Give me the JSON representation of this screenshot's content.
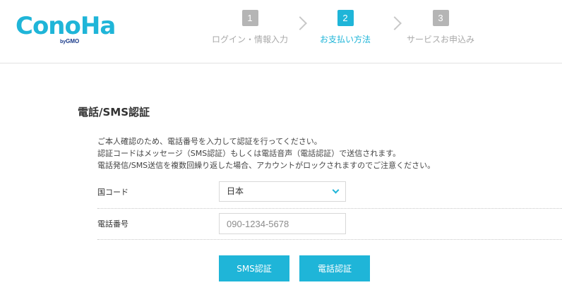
{
  "logo": {
    "text": "ConoHa",
    "by": "by",
    "brand": "GMO"
  },
  "steps": [
    {
      "number": "1",
      "label": "ログイン・情報入力",
      "state": "done"
    },
    {
      "number": "2",
      "label": "お支払い方法",
      "state": "active"
    },
    {
      "number": "3",
      "label": "サービスお申込み",
      "state": "upcoming"
    }
  ],
  "page_title": "電話/SMS認証",
  "description": [
    "ご本人確認のため、電話番号を入力して認証を行ってください。",
    "認証コードはメッセージ（SMS認証）もしくは電話音声（電話認証）で送信されます。",
    "電話発信/SMS送信を複数回繰り返した場合、アカウントがロックされますのでご注意ください。"
  ],
  "form": {
    "country_label": "国コード",
    "country_value": "日本",
    "phone_label": "電話番号",
    "phone_placeholder": "090-1234-5678",
    "phone_value": ""
  },
  "buttons": {
    "sms": "SMS認証",
    "voice": "電話認証"
  },
  "colors": {
    "accent": "#1fb5d8",
    "inactive_step": "#b5b5b5",
    "inactive_text": "#a9a9a9",
    "text": "#333333"
  },
  "icons": {
    "select_caret": "chevron-down-icon",
    "step_separator": "chevron-right-icon"
  }
}
